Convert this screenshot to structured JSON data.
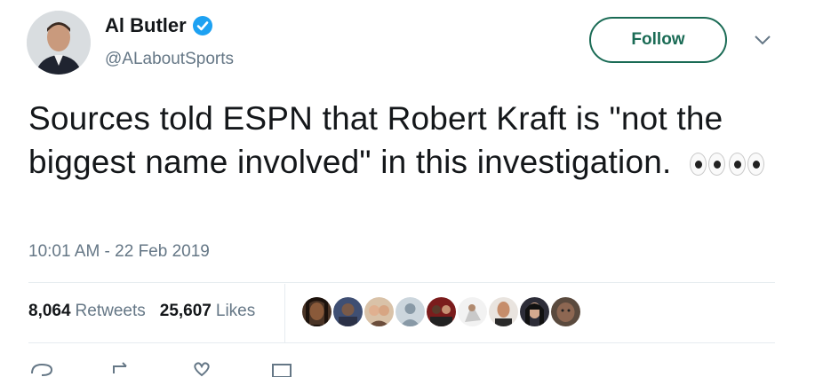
{
  "author": {
    "display_name": "Al Butler",
    "handle": "@ALaboutSports",
    "avatar_icon": "user-avatar",
    "verified_icon": "verified-badge-icon"
  },
  "follow_label": "Follow",
  "tweet": {
    "text": "Sources told ESPN that Robert Kraft is \"not the biggest name involved\" in this investigation.",
    "emoji": "eyes-emoji eyes-emoji"
  },
  "timestamp": "10:01 AM - 22 Feb 2019",
  "stats": {
    "retweets_count": "8,064",
    "retweets_label": "Retweets",
    "likes_count": "25,607",
    "likes_label": "Likes"
  },
  "likers": [
    {
      "icon": "liker-avatar"
    },
    {
      "icon": "liker-avatar"
    },
    {
      "icon": "liker-avatar"
    },
    {
      "icon": "liker-avatar"
    },
    {
      "icon": "liker-avatar"
    },
    {
      "icon": "liker-avatar"
    },
    {
      "icon": "liker-avatar"
    },
    {
      "icon": "liker-avatar"
    },
    {
      "icon": "liker-avatar"
    }
  ],
  "colors": {
    "accent": "#1a6b55",
    "verified": "#1da1f2",
    "muted": "#657786"
  }
}
